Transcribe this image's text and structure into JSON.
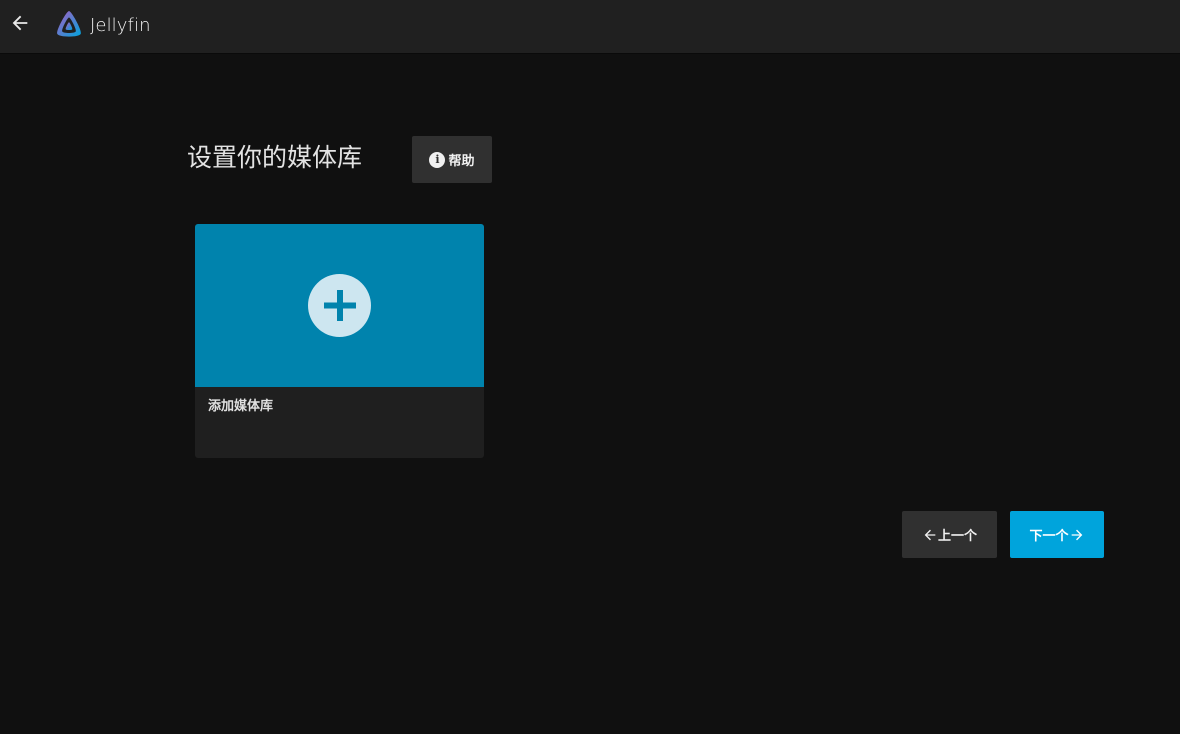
{
  "header": {
    "back_icon": "arrow-left-icon",
    "brand_logo_icon": "jellyfin-logo-icon",
    "brand_name": "Jellyfin"
  },
  "main": {
    "title": "设置你的媒体库",
    "help_button": {
      "icon": "info-icon",
      "label": "帮助"
    },
    "library_card": {
      "icon": "add-icon",
      "label": "添加媒体库"
    }
  },
  "footer_nav": {
    "prev_label": "上一个",
    "next_label": "下一个"
  },
  "colors": {
    "background": "#101010",
    "header": "#202020",
    "accent": "#00a4dc",
    "card_image": "#0083ad",
    "secondary_button": "#303030"
  }
}
